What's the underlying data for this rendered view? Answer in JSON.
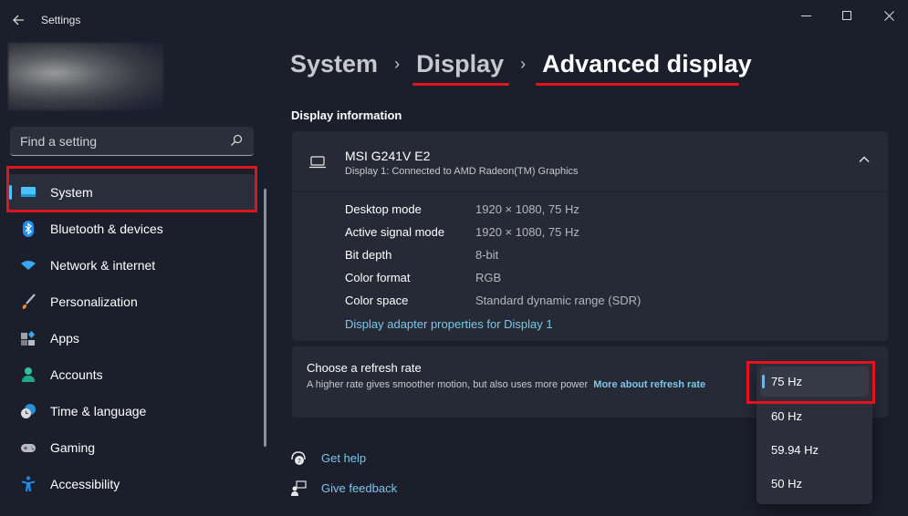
{
  "window": {
    "app_title": "Settings",
    "controls": {
      "minimize": "minimize",
      "maximize": "maximize",
      "close": "close"
    }
  },
  "search": {
    "placeholder": "Find a setting",
    "value": ""
  },
  "sidebar": {
    "items": [
      {
        "label": "System",
        "icon": "system-display-icon",
        "active": true
      },
      {
        "label": "Bluetooth & devices",
        "icon": "bluetooth-icon",
        "active": false
      },
      {
        "label": "Network & internet",
        "icon": "wifi-icon",
        "active": false
      },
      {
        "label": "Personalization",
        "icon": "paintbrush-icon",
        "active": false
      },
      {
        "label": "Apps",
        "icon": "apps-icon",
        "active": false
      },
      {
        "label": "Accounts",
        "icon": "person-icon",
        "active": false
      },
      {
        "label": "Time & language",
        "icon": "clock-globe-icon",
        "active": false
      },
      {
        "label": "Gaming",
        "icon": "gamepad-icon",
        "active": false
      },
      {
        "label": "Accessibility",
        "icon": "accessibility-icon",
        "active": false
      }
    ]
  },
  "breadcrumb": {
    "items": [
      "System",
      "Display",
      "Advanced display"
    ],
    "separator": "›"
  },
  "display_info": {
    "section_title": "Display information",
    "monitor_name": "MSI G241V E2",
    "monitor_subtitle": "Display 1: Connected to AMD Radeon(TM) Graphics",
    "rows": [
      {
        "label": "Desktop mode",
        "value": "1920 × 1080, 75 Hz"
      },
      {
        "label": "Active signal mode",
        "value": "1920 × 1080, 75 Hz"
      },
      {
        "label": "Bit depth",
        "value": "8-bit"
      },
      {
        "label": "Color format",
        "value": "RGB"
      },
      {
        "label": "Color space",
        "value": "Standard dynamic range (SDR)"
      }
    ],
    "adapter_link": "Display adapter properties for Display 1"
  },
  "refresh_rate": {
    "title": "Choose a refresh rate",
    "description": "A higher rate gives smoother motion, but also uses more power",
    "link": "More about refresh rate",
    "selected": "75 Hz",
    "options": [
      "75 Hz",
      "60 Hz",
      "59.94 Hz",
      "50 Hz"
    ]
  },
  "help": {
    "get_help": "Get help",
    "give_feedback": "Give feedback"
  },
  "colors": {
    "accent": "#4cc2ff",
    "link": "#7dc6e8",
    "annotation_red": "#e0141b",
    "background": "#1b1f2c",
    "card": "#262a37"
  }
}
